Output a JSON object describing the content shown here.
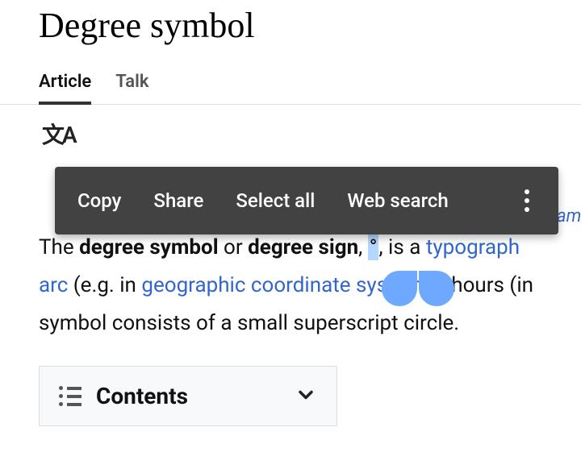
{
  "page": {
    "title": "Degree symbol"
  },
  "tabs": {
    "article": "Article",
    "talk": "Talk"
  },
  "context_menu": {
    "copy": "Copy",
    "share": "Share",
    "select_all": "Select all",
    "web_search": "Web search"
  },
  "partial_link": "ambiguation)",
  "article": {
    "t1": "The ",
    "b1": "degree symbol",
    "t2": " or ",
    "b2": "degree sign",
    "t3": ", ",
    "selected": "°",
    "t4": ", is a ",
    "link_typograph": "typograph",
    "link_arc": "arc",
    "t5": " (e.g. in ",
    "link_geo": "geographic coordinate systems",
    "t6": "), hours (in",
    "t7": "symbol consists of a small superscript circle."
  },
  "contents": {
    "label": "Contents"
  }
}
